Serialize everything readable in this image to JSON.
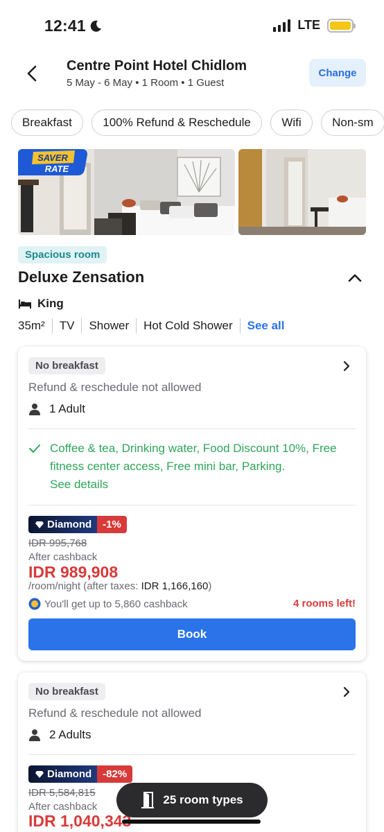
{
  "status": {
    "time": "12:41",
    "network": "LTE",
    "battery_color": "#f5c518"
  },
  "header": {
    "title": "Centre Point Hotel Chidlom",
    "subtitle": "5 May - 6 May • 1 Room • 1 Guest",
    "change_label": "Change"
  },
  "filters": [
    "Breakfast",
    "100% Refund & Reschedule",
    "Wifi",
    "Non-sm"
  ],
  "photos": {
    "badge_line1": "SAVER",
    "badge_line2": "RATE"
  },
  "room": {
    "tag": "Spacious room",
    "name": "Deluxe Zensation",
    "bed": "King",
    "amenities": [
      "35m²",
      "TV",
      "Shower",
      "Hot Cold Shower"
    ],
    "see_all": "See all"
  },
  "offers": [
    {
      "meal": "No breakfast",
      "policy": "Refund & reschedule not allowed",
      "guests": "1 Adult",
      "perks": "Coffee & tea, Drinking water, Food Discount 10%, Free fitness center access, Free mini bar, Parking.",
      "see_details": "See details",
      "tier": "Diamond",
      "discount": "-1%",
      "original_price": "IDR 995,768",
      "after_cashback": "After cashback",
      "price": "IDR 989,908",
      "per_night": "/room/night (after taxes: ",
      "after_taxes_price": "IDR 1,166,160",
      "per_night_close": ")",
      "cashback": "You'll get up to 5,860 cashback",
      "rooms_left": "4 rooms left!",
      "book_label": "Book"
    },
    {
      "meal": "No breakfast",
      "policy": "Refund & reschedule not allowed",
      "guests": "2 Adults",
      "tier": "Diamond",
      "discount": "-82%",
      "original_price": "IDR 5,584,815",
      "after_cashback": "After cashback",
      "price": "IDR 1,040,343"
    }
  ],
  "floating": {
    "label": "25 room types"
  },
  "colors": {
    "accent_blue": "#2a73e8",
    "price_red": "#d83a3a",
    "perk_green": "#2fa55a",
    "tag_teal": "#1a8a93"
  }
}
